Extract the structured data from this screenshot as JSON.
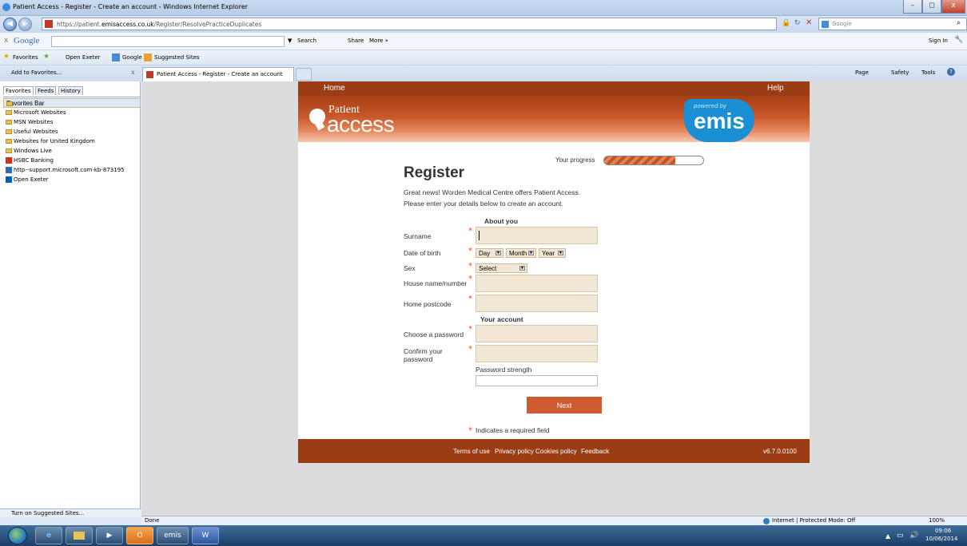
{
  "window": {
    "title": "Patient Access  - Register - Create an account - Windows Internet Explorer"
  },
  "address": {
    "url_prefix": "https://patient.",
    "url_domain": "emisaccess.co.uk",
    "url_path": "/Register/ResolvePracticeDuplicates",
    "search_placeholder": "Google"
  },
  "google_toolbar": {
    "brand": "Google",
    "search": "Search",
    "share": "Share",
    "more": "More »",
    "signin": "Sign In"
  },
  "favorites_bar": {
    "favorites": "Favorites",
    "open_exeter": "Open Exeter",
    "google": "Google",
    "suggested": "Suggested Sites"
  },
  "command_bar": {
    "add_favorites": "Add to Favorites...",
    "tab_title": "Patient Access  - Register - Create an account",
    "page": "Page",
    "safety": "Safety",
    "tools": "Tools"
  },
  "left_pane": {
    "tabs": [
      "Favorites",
      "Feeds",
      "History"
    ],
    "items": [
      {
        "label": "Favorites Bar",
        "icon": "folder-icon"
      },
      {
        "label": "Microsoft Websites",
        "icon": "folder-icon"
      },
      {
        "label": "MSN Websites",
        "icon": "folder-icon"
      },
      {
        "label": "Useful Websites",
        "icon": "folder-icon"
      },
      {
        "label": "Websites for United Kingdom",
        "icon": "folder-icon"
      },
      {
        "label": "Windows Live",
        "icon": "folder-icon"
      },
      {
        "label": "HSBC Banking",
        "icon": "hsbc-icon"
      },
      {
        "label": "http--support.microsoft.com-kb-873195",
        "icon": "page-icon"
      },
      {
        "label": "Open Exeter",
        "icon": "nhs-icon"
      }
    ],
    "bottom": "Turn on Suggested Sites..."
  },
  "site": {
    "nav": {
      "home": "Home",
      "help": "Help"
    },
    "logo": {
      "line1": "Patient",
      "line2": "access"
    },
    "emis": {
      "powered": "powered by",
      "name": "emis"
    },
    "progress": {
      "label": "Your progress",
      "value": 0.72
    },
    "heading": "Register",
    "intro1": "Great news! Worden Medical Centre offers Patient Access.",
    "intro2": "Please enter your details below to create an account.",
    "about_you": "About you",
    "surname": "Surname",
    "dob": "Date of birth",
    "day": "Day",
    "month": "Month",
    "year": "Year",
    "sex": "Sex",
    "sex_select": "Select",
    "house": "House name/number",
    "postcode": "Home postcode",
    "your_account": "Your account",
    "choose_password": "Choose a password",
    "confirm_password1": "Confirm your",
    "confirm_password2": "password",
    "password_strength": "Password strength",
    "next": "Next",
    "required": "Indicates a required field",
    "footer": {
      "terms": "Terms of use",
      "privacy": "Privacy policy",
      "cookies": "Cookies policy",
      "feedback": "Feedback",
      "version": "v6.7.0.0100"
    }
  },
  "statusbar": {
    "done": "Done",
    "zone": "Internet | Protected Mode: Off",
    "zoom": "100%"
  },
  "taskbar": {
    "time": "09:06",
    "date": "10/06/2014",
    "emis_label": "emis"
  },
  "colors": {
    "brand_dark": "#9a3c14",
    "brand_button": "#cf5a30",
    "emis_blue": "#1a8fd3",
    "input_fill": "#f1e7d4"
  }
}
